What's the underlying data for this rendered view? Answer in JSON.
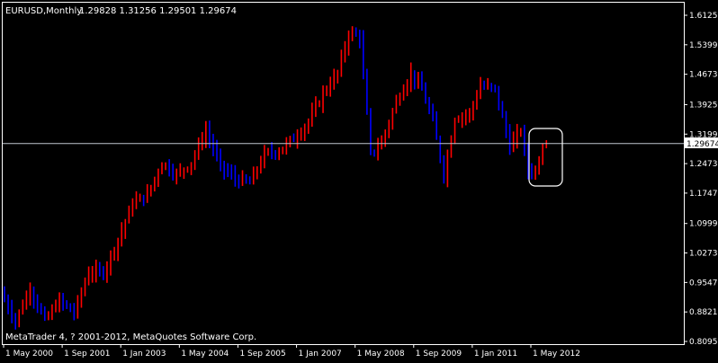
{
  "header": {
    "symbol": "EURUSD,Monthly",
    "ohlc": "1.29828 1.31256 1.29501 1.29674"
  },
  "footer": {
    "copyright": "MetaTrader 4, ? 2001-2012, MetaQuotes Software Corp."
  },
  "colors": {
    "background": "#000000",
    "frame": "#ffffff",
    "bull": "#ff0000",
    "bear": "#0000ff",
    "price_line": "#c0c8d0",
    "text": "#ffffff"
  },
  "chart_data": {
    "type": "bar",
    "title": "EURUSD,Monthly",
    "ylim": [
      0.8,
      1.63
    ],
    "y_ticks": [
      "1.61250",
      "1.53990",
      "1.46730",
      "1.39250",
      "1.31990",
      "1.24730",
      "1.17470",
      "1.09990",
      "1.02730",
      "0.95470",
      "0.88210",
      "0.80950"
    ],
    "x_ticks": [
      "1 May 2000",
      "1 Sep 2001",
      "1 Jan 2003",
      "1 May 2004",
      "1 Sep 2005",
      "1 Jan 2007",
      "1 May 2008",
      "1 Sep 2009",
      "1 Jan 2011",
      "1 May 2012"
    ],
    "current_price": "1.29674",
    "current_price_value": 1.29674,
    "grid": false,
    "series": [
      {
        "x": [
          "2000-05",
          "2000-09",
          "2001-01",
          "2001-05",
          "2001-09",
          "2002-01",
          "2002-05",
          "2002-09",
          "2003-01",
          "2003-05",
          "2003-09",
          "2004-01",
          "2004-05",
          "2004-09",
          "2005-01",
          "2005-05",
          "2005-09",
          "2006-01",
          "2006-05",
          "2006-09",
          "2007-01",
          "2007-05",
          "2007-09",
          "2008-01",
          "2008-04",
          "2008-07",
          "2008-10",
          "2009-01",
          "2009-05",
          "2009-09",
          "2009-12",
          "2010-03",
          "2010-06",
          "2010-09",
          "2011-01",
          "2011-04",
          "2011-08",
          "2011-12",
          "2012-03",
          "2012-05",
          "2012-07",
          "2012-09"
        ],
        "values": [
          0.93,
          0.86,
          0.94,
          0.86,
          0.91,
          0.88,
          0.98,
          0.98,
          1.06,
          1.15,
          1.17,
          1.25,
          1.22,
          1.25,
          1.33,
          1.24,
          1.21,
          1.2,
          1.27,
          1.28,
          1.31,
          1.35,
          1.42,
          1.47,
          1.57,
          1.56,
          1.27,
          1.3,
          1.4,
          1.47,
          1.43,
          1.35,
          1.22,
          1.36,
          1.37,
          1.44,
          1.43,
          1.29,
          1.33,
          1.23,
          1.23,
          1.29
        ]
      }
    ]
  }
}
